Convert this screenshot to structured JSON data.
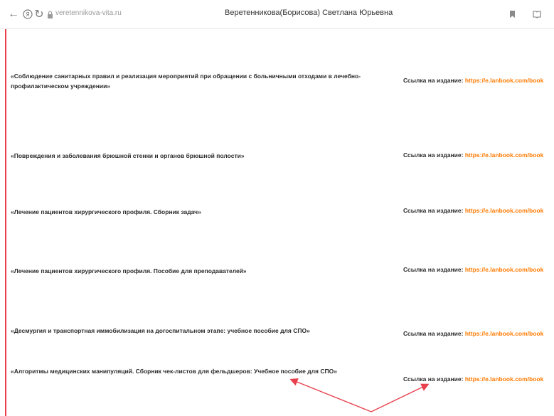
{
  "browser": {
    "url": "veretennikova-vita.ru",
    "window_title": "Веретенникова(Борисова) Светлана Юрьевна"
  },
  "items": [
    {
      "title": "«Соблюдение санитарных правил и реализация мероприятий при обращении с больничными отходами в лечебно-профилактическом учреждении»",
      "label": "Ссылка на издание:",
      "url": "https://e.lanbook.com/book"
    },
    {
      "title": "«Повреждения и заболевания брюшной стенки и органов брюшной полости»",
      "label": "Ссылка на издание:",
      "url": "https://e.lanbook.com/book"
    },
    {
      "title": "«Лечение пациентов хирургического профиля. Сборник задач»",
      "label": "Ссылка на издание:",
      "url": "https://e.lanbook.com/book"
    },
    {
      "title": "«Лечение пациентов хирургического профиля. Пособие для преподавателей»",
      "label": "Ссылка на издание:",
      "url": "https://e.lanbook.com/book"
    },
    {
      "title": "«Десмургия и транспортная иммобилизация на догоспитальном этапе: учебное пособие для СПО»",
      "label": "Ссылка на издание:",
      "url": "https://e.lanbook.com/book"
    },
    {
      "title": "«Алгоритмы медицинских манипуляций. Сборник чек-листов для фельдшеров: Учебное пособие для СПО»",
      "label": "Ссылка на издание:",
      "url": "https://e.lanbook.com/book"
    }
  ],
  "colors": {
    "link": "#ff7a00",
    "accent_line": "#e8414d",
    "annotation_arrow": "#e8414d"
  }
}
